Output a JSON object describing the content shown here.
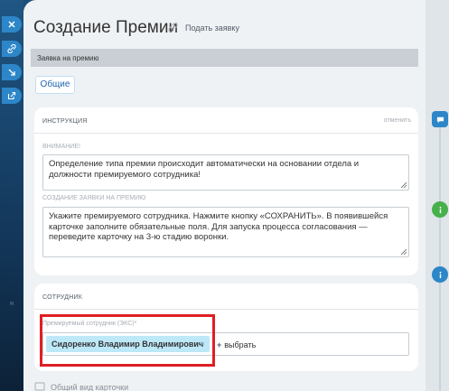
{
  "header": {
    "title": "Создание Премии",
    "submit_link": "Подать заявку"
  },
  "breadcrumb": "Заявка на премию",
  "tabs": [
    {
      "label": "Общие"
    }
  ],
  "instruction_card": {
    "title": "ИНСТРУКЦИЯ",
    "cancel": "отменить",
    "attention_label": "ВНИМАНИЕ!",
    "attention_text": "Определение типа премии происходит автоматически на основании отдела и должности премируемого сотрудника!",
    "create_label": "СОЗДАНИЕ ЗАЯВКИ НА ПРЕМИЮ",
    "create_text": "Укажите премируемого сотрудника. Нажмите кнопку «СОХРАНИТЬ». В появившейся карточке заполните обязательные поля. Для запуска процесса согласования — переведите карточку на 3-ю стадию воронки."
  },
  "employee_card": {
    "title": "СОТРУДНИК",
    "field_label": "Премируемый сотрудник (ЭКС)*",
    "selected_employee": "Сидоренко Владимир Владимирович",
    "remove_glyph": "×",
    "add_label": "выбрать",
    "add_glyph": "+"
  },
  "footer": {
    "general_view": "Общий вид карточки"
  },
  "rail": {
    "text": "н"
  },
  "colors": {
    "accent": "#2d86c8",
    "highlight": "#e01f24",
    "tag_bg": "#bde8f8",
    "info_green": "#47b04b",
    "info_blue": "#2d86c8"
  },
  "icons": [
    "close-icon",
    "link-icon",
    "arrow-icon",
    "open-window-icon",
    "chat-icon",
    "info-icon"
  ]
}
